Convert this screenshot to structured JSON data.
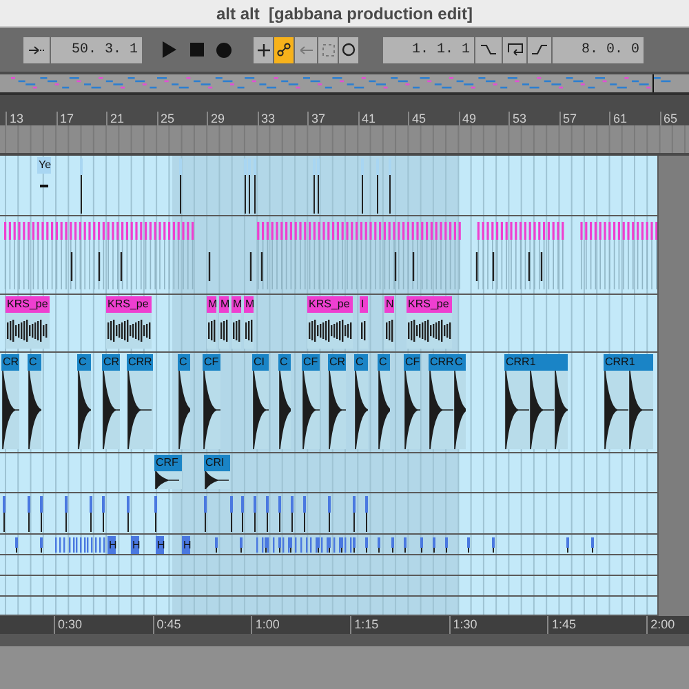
{
  "window": {
    "title": "alt alt  [gabbana production edit]"
  },
  "transport": {
    "position": "50. 3. 1",
    "loop_start": "1. 1. 1",
    "loop_length": "8. 0. 0",
    "toggles": [
      {
        "kind": "add",
        "on": false
      },
      {
        "kind": "automation",
        "on": true
      },
      {
        "kind": "back",
        "on": false
      },
      {
        "kind": "punch",
        "on": false
      },
      {
        "kind": "circle",
        "on": false
      }
    ]
  },
  "ruler": {
    "bars": [
      "13",
      "17",
      "21",
      "25",
      "29",
      "33",
      "37",
      "41",
      "45",
      "49",
      "53",
      "57",
      "61",
      "65"
    ]
  },
  "tracks": [
    {
      "kind": "audio",
      "color": "#a9d6f2",
      "clips": [
        {
          "label": "Ye"
        }
      ]
    },
    {
      "kind": "midi",
      "color": "#ee3fd0"
    },
    {
      "kind": "audio",
      "color": "#ee3fd0",
      "clips": [
        {
          "label": "KRS_pe"
        },
        {
          "label": "KRS_pe"
        },
        {
          "label": "M"
        },
        {
          "label": "M"
        },
        {
          "label": "M"
        },
        {
          "label": "M"
        },
        {
          "label": "KRS_pe"
        },
        {
          "label": "I"
        },
        {
          "label": "N"
        },
        {
          "label": "KRS_pe"
        }
      ]
    },
    {
      "kind": "audio",
      "color": "#1a84c6",
      "clips": [
        {
          "label": "CR"
        },
        {
          "label": "C"
        },
        {
          "label": "C"
        },
        {
          "label": "CR"
        },
        {
          "label": "CRR"
        },
        {
          "label": "C"
        },
        {
          "label": "CF"
        },
        {
          "label": "CI"
        },
        {
          "label": "C"
        },
        {
          "label": "CF"
        },
        {
          "label": "CR"
        },
        {
          "label": "C"
        },
        {
          "label": "C"
        },
        {
          "label": "CF"
        },
        {
          "label": "CRR"
        },
        {
          "label": "C"
        },
        {
          "label": "CRR1"
        },
        {
          "label": "CRR1"
        }
      ]
    },
    {
      "kind": "audio",
      "color": "#1a84c6",
      "clips": [
        {
          "label": "CRF"
        },
        {
          "label": "CRI"
        }
      ]
    },
    {
      "kind": "audio",
      "color": "#4a78e0"
    },
    {
      "kind": "audio",
      "color": "#4a78e0",
      "clips": [
        {
          "label": "H"
        },
        {
          "label": "H"
        },
        {
          "label": "H"
        },
        {
          "label": "H"
        }
      ]
    },
    {
      "kind": "empty"
    },
    {
      "kind": "empty"
    },
    {
      "kind": "empty"
    }
  ],
  "timeline": {
    "times": [
      "0:30",
      "0:45",
      "1:00",
      "1:15",
      "1:30",
      "1:45",
      "2:00"
    ]
  }
}
